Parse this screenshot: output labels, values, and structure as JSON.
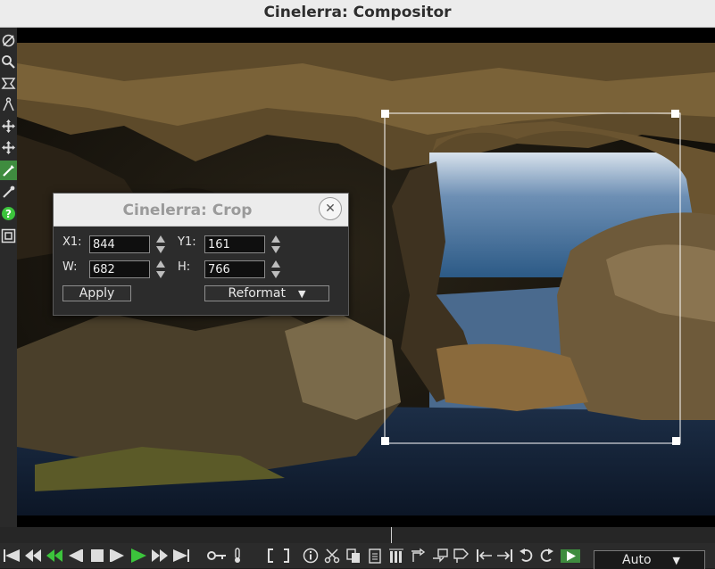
{
  "window": {
    "title": "Cinelerra: Compositor"
  },
  "toolbar_icons": [
    "protect-icon",
    "zoom-icon",
    "mask-icon",
    "ruler-icon",
    "camera-icon",
    "projector-icon",
    "crop-icon",
    "eyedropper-icon",
    "help-icon",
    "safe-region-icon"
  ],
  "crop_dialog": {
    "title": "Cinelerra: Crop",
    "x1_label": "X1:",
    "x1_value": "844",
    "y1_label": "Y1:",
    "y1_value": "161",
    "w_label": "W:",
    "w_value": "682",
    "h_label": "H:",
    "h_value": "766",
    "apply_label": "Apply",
    "reformat_label": "Reformat"
  },
  "transport": {
    "zoom_value": "Auto"
  },
  "colors": {
    "accent_green": "#3f8c3f",
    "play_green": "#3cc43c"
  }
}
